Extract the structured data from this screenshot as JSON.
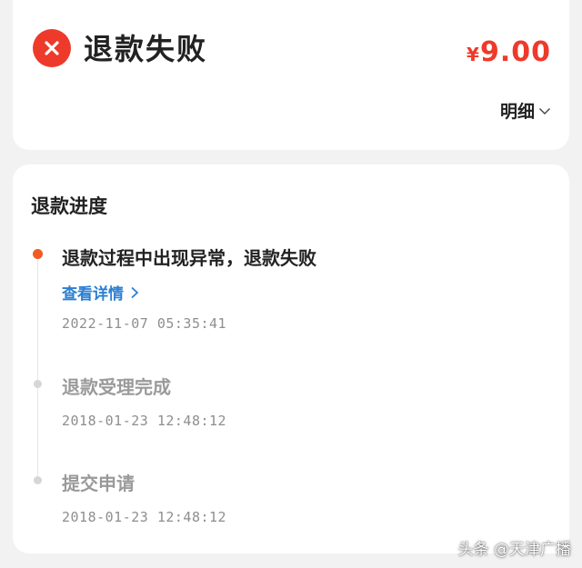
{
  "header": {
    "status_title": "退款失败",
    "status_icon": "close-circle-icon",
    "amount_currency": "¥",
    "amount_value": "9.00",
    "detail_label": "明细",
    "detail_icon": "chevron-down-icon"
  },
  "progress": {
    "title": "退款进度",
    "steps": [
      {
        "title": "退款过程中出现异常，退款失败",
        "link_label": "查看详情",
        "time": "2022-11-07  05:35:41",
        "state": "active"
      },
      {
        "title": "退款受理完成",
        "time": "2018-01-23  12:48:12",
        "state": "inactive"
      },
      {
        "title": "提交申请",
        "time": "2018-01-23  12:48:12",
        "state": "inactive"
      }
    ]
  },
  "watermark": "头条 @天津广播",
  "colors": {
    "accent_red": "#ee3a2a",
    "timeline_active": "#f15a24",
    "link_blue": "#2a7fd4"
  }
}
